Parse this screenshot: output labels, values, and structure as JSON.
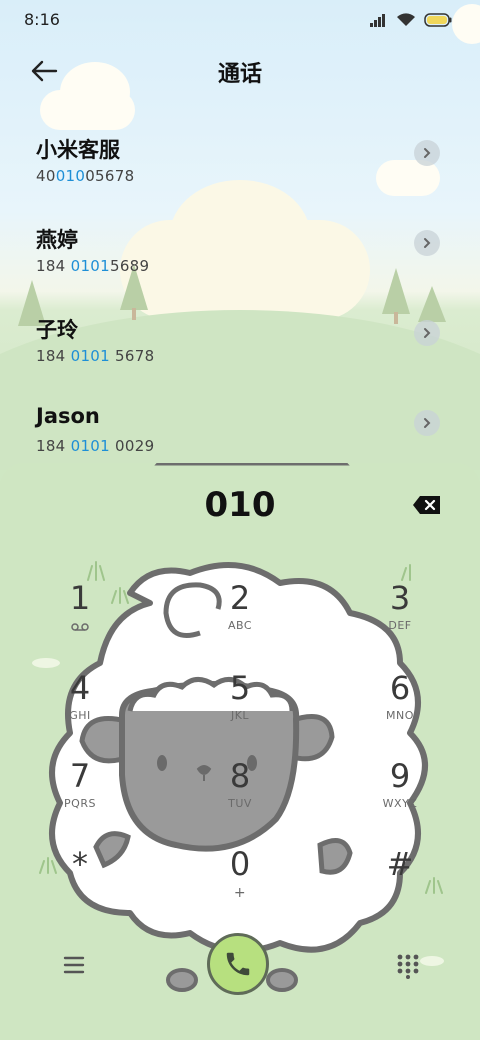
{
  "status_bar": {
    "time": "8:16",
    "icons": [
      "signal-icon",
      "wifi-icon",
      "battery-icon"
    ]
  },
  "header": {
    "back_icon": "back-arrow-icon",
    "title": "通话"
  },
  "contacts": [
    {
      "name": "小米客服",
      "number_prefix": "40",
      "number_match": "010",
      "number_suffix": "05678"
    },
    {
      "name": "燕婷",
      "number_prefix": "184 ",
      "number_match": "0101",
      "number_suffix": "5689"
    },
    {
      "name": "子玲",
      "number_prefix": "184 ",
      "number_match": "0101",
      "number_suffix": " 5678"
    },
    {
      "name": "Jason",
      "number_prefix": "184 ",
      "number_match": "0101",
      "number_suffix": " 0029"
    }
  ],
  "dialer": {
    "dialed_number": "010",
    "keys": [
      {
        "digit": "1",
        "letters": ""
      },
      {
        "digit": "2",
        "letters": "ABC"
      },
      {
        "digit": "3",
        "letters": "DEF"
      },
      {
        "digit": "4",
        "letters": "GHI"
      },
      {
        "digit": "5",
        "letters": "JKL"
      },
      {
        "digit": "6",
        "letters": "MNO"
      },
      {
        "digit": "7",
        "letters": "PQRS"
      },
      {
        "digit": "8",
        "letters": "TUV"
      },
      {
        "digit": "9",
        "letters": "WXYZ"
      },
      {
        "digit": "*",
        "letters": ""
      },
      {
        "digit": "0",
        "letters": "+"
      },
      {
        "digit": "#",
        "letters": ""
      }
    ]
  },
  "colors": {
    "accent_match": "#1e8fd6",
    "call_button": "#b7e07f",
    "dial_panel_bg": "#cfe6c2"
  }
}
